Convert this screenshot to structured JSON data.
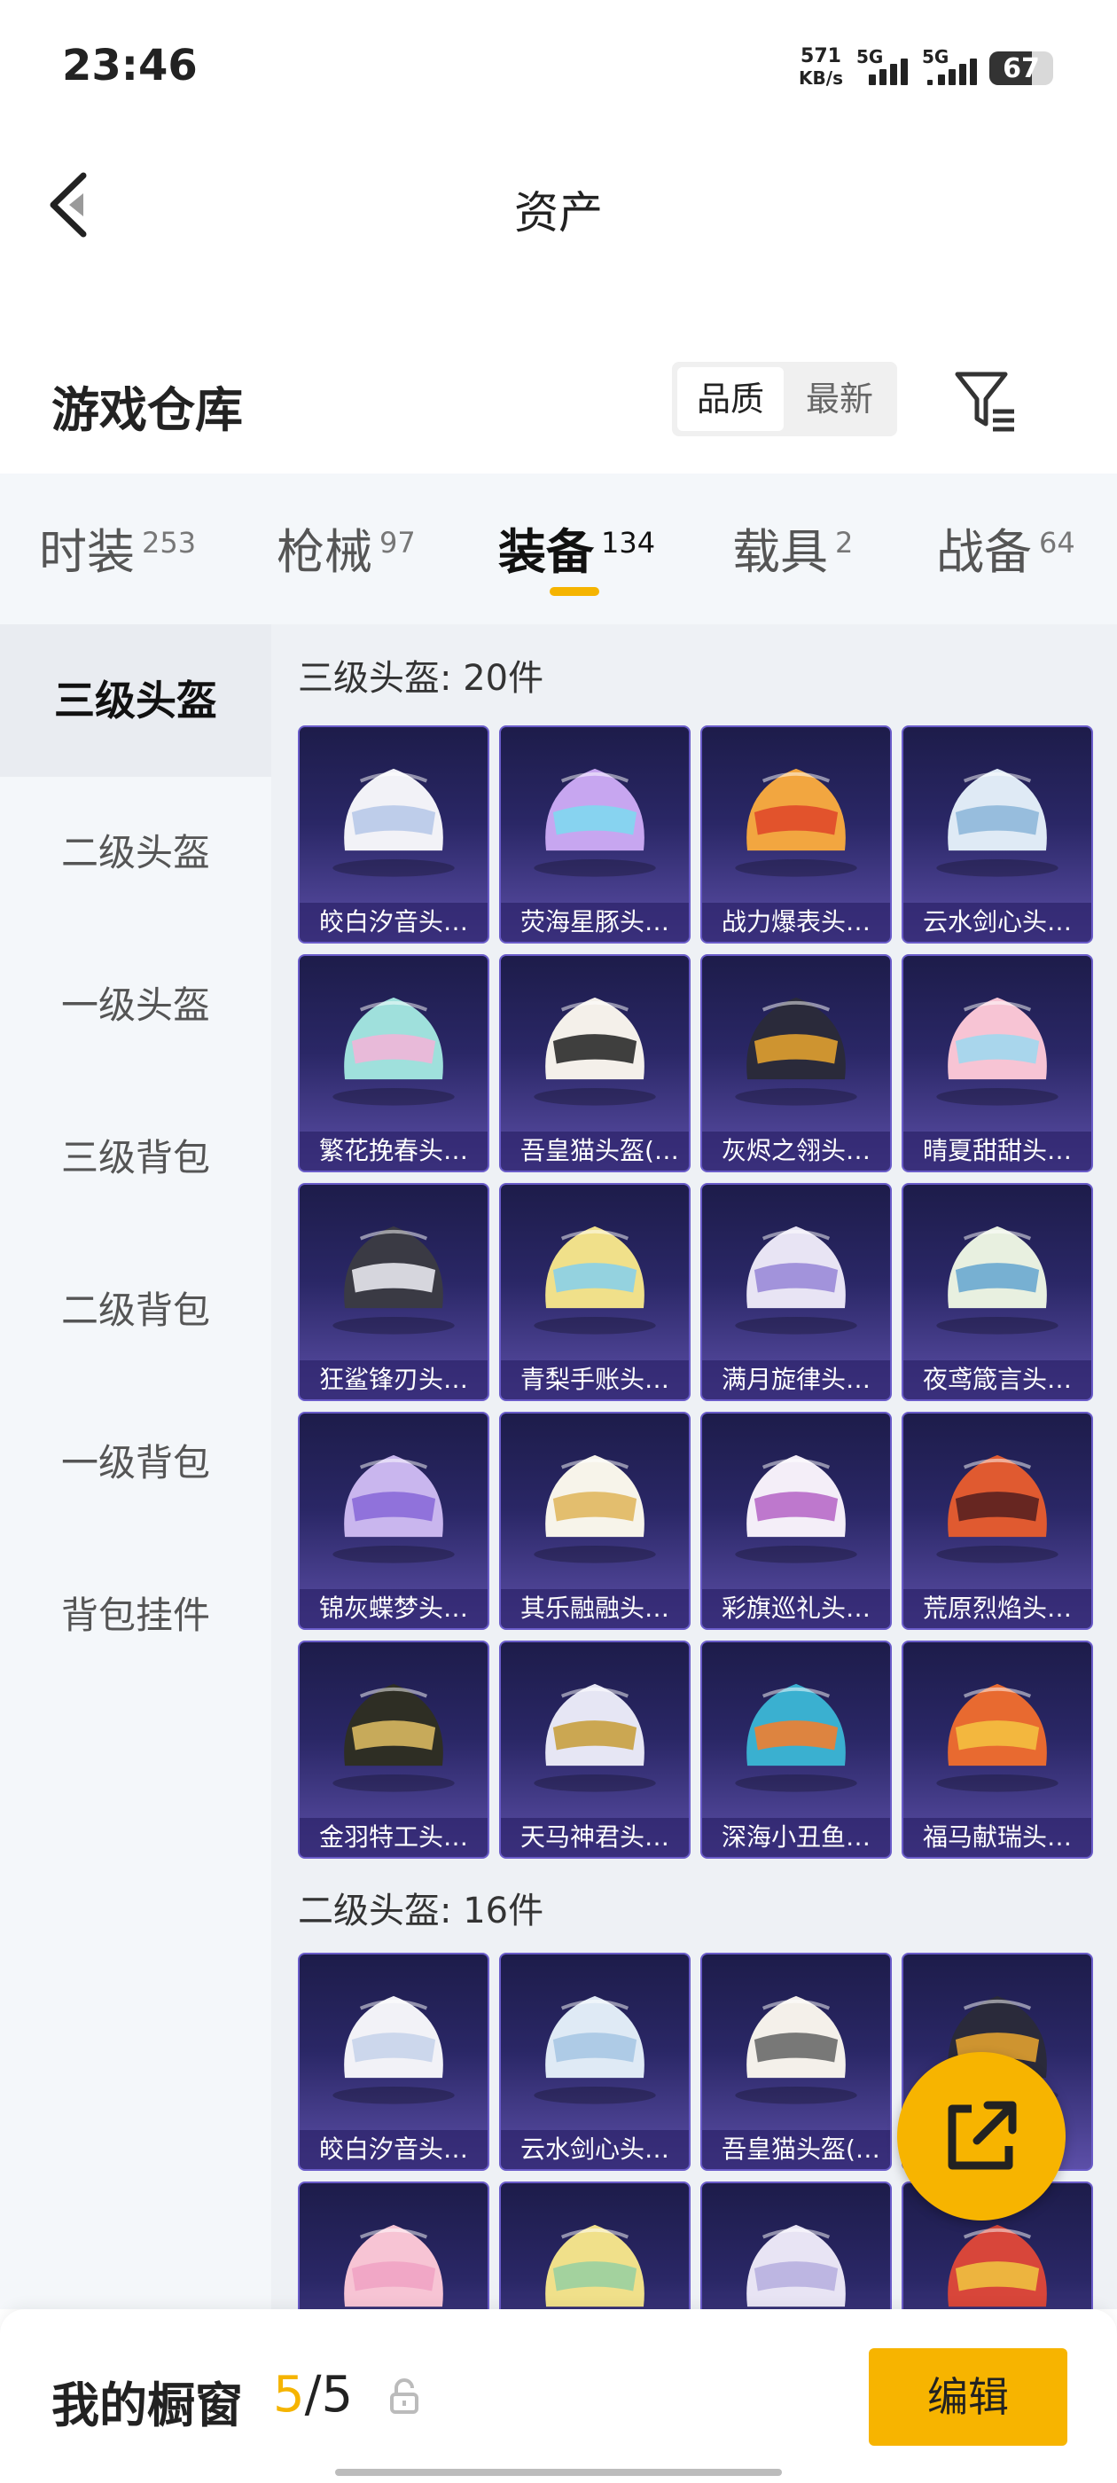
{
  "status_bar": {
    "time": "23:46",
    "net_speed_value": "571",
    "net_speed_unit": "KB/s",
    "signal1_label": "5G",
    "signal2_label": "5G",
    "battery": "67"
  },
  "header": {
    "title": "资产",
    "section_title": "游戏仓库",
    "sort_options": [
      "品质",
      "最新"
    ],
    "sort_selected": "品质"
  },
  "tabs": [
    {
      "label": "时装",
      "count": "253"
    },
    {
      "label": "枪械",
      "count": "97"
    },
    {
      "label": "装备",
      "count": "134",
      "active": true
    },
    {
      "label": "载具",
      "count": "2"
    },
    {
      "label": "战备",
      "count": "64"
    }
  ],
  "sidebar": {
    "items": [
      "三级头盔",
      "二级头盔",
      "一级头盔",
      "三级背包",
      "二级背包",
      "一级背包",
      "背包挂件"
    ],
    "active": "三级头盔"
  },
  "groups": [
    {
      "title": "三级头盔: 20件",
      "items": [
        {
          "name": "皎白汐音头…",
          "palette": [
            "#f2f2f7",
            "#b8c9e8"
          ]
        },
        {
          "name": "荧海星豚头…",
          "palette": [
            "#c7a6f0",
            "#7fd8f0"
          ]
        },
        {
          "name": "战力爆表头…",
          "palette": [
            "#f2a640",
            "#e04a2a"
          ]
        },
        {
          "name": "云水剑心头…",
          "palette": [
            "#dfeaf5",
            "#8fb8da"
          ]
        },
        {
          "name": "繁花挽春头…",
          "palette": [
            "#9fe0dc",
            "#f0b6d8"
          ]
        },
        {
          "name": "吾皇猫头盔(…",
          "palette": [
            "#f4f0ea",
            "#2b2b2b"
          ]
        },
        {
          "name": "灰烬之翎头…",
          "palette": [
            "#2a2a3a",
            "#e0a030"
          ]
        },
        {
          "name": "晴夏甜甜头…",
          "palette": [
            "#f7c4d4",
            "#a0d8ee"
          ]
        },
        {
          "name": "狂鲨锋刃头…",
          "palette": [
            "#3a3a44",
            "#e8e8ee"
          ]
        },
        {
          "name": "青梨手账头…",
          "palette": [
            "#f0e08a",
            "#8ad0e8"
          ]
        },
        {
          "name": "满月旋律头…",
          "palette": [
            "#e8e4f4",
            "#9a8ad8"
          ]
        },
        {
          "name": "夜鸢箴言头…",
          "palette": [
            "#e8f0e0",
            "#6aa8d0"
          ]
        },
        {
          "name": "锦灰蝶梦头…",
          "palette": [
            "#c9b6ee",
            "#8a6ad8"
          ]
        },
        {
          "name": "其乐融融头…",
          "palette": [
            "#f7f4ea",
            "#e0b860"
          ]
        },
        {
          "name": "彩旗巡礼头…",
          "palette": [
            "#f4eef8",
            "#b86ac8"
          ]
        },
        {
          "name": "荒原烈焰头…",
          "palette": [
            "#e05a30",
            "#5a2020"
          ]
        },
        {
          "name": "金羽特工头…",
          "palette": [
            "#2e2e24",
            "#d8b860"
          ]
        },
        {
          "name": "天马神君头…",
          "palette": [
            "#e6e6f4",
            "#c8a040"
          ]
        },
        {
          "name": "深海小丑鱼…",
          "palette": [
            "#3ab0d0",
            "#f08030"
          ]
        },
        {
          "name": "福马献瑞头…",
          "palette": [
            "#e86a30",
            "#f4c040"
          ]
        }
      ]
    },
    {
      "title": "二级头盔: 16件",
      "items": [
        {
          "name": "皎白汐音头…",
          "palette": [
            "#f2f2f7",
            "#c8d4ea"
          ]
        },
        {
          "name": "云水剑心头…",
          "palette": [
            "#dfeaf5",
            "#a8c8e4"
          ]
        },
        {
          "name": "吾皇猫头盔(…",
          "palette": [
            "#f4f0ea",
            "#6a6a6a"
          ]
        },
        {
          "name": "",
          "palette": [
            "#2a2a3a",
            "#e0a030"
          ]
        },
        {
          "name": "",
          "palette": [
            "#f7c4d4",
            "#f0a4c4"
          ]
        },
        {
          "name": "",
          "palette": [
            "#f0e08a",
            "#9ad0a0"
          ]
        },
        {
          "name": "",
          "palette": [
            "#e8e4f4",
            "#b8b0e0"
          ]
        },
        {
          "name": "",
          "palette": [
            "#d8463a",
            "#f0c040"
          ]
        }
      ]
    }
  ],
  "bottom_bar": {
    "label": "我的橱窗",
    "current": "5",
    "separator": "/",
    "total": "5",
    "edit_label": "编辑"
  },
  "colors": {
    "accent": "#f5b400",
    "card_top": "#1d1c4a",
    "card_bottom": "#5c4fa8",
    "card_border": "#6a5cc9"
  }
}
